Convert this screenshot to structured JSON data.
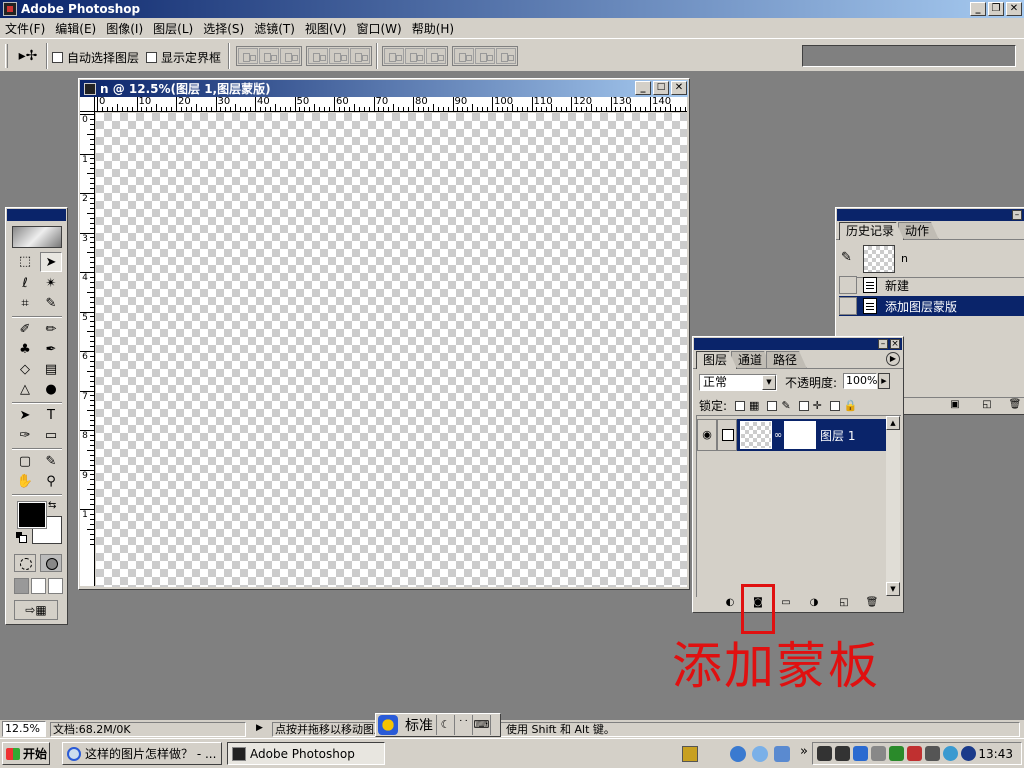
{
  "app": {
    "title": "Adobe Photoshop",
    "window_controls": [
      "_",
      "❐",
      "✕"
    ]
  },
  "menubar": {
    "items": [
      {
        "label": "文件(F)"
      },
      {
        "label": "编辑(E)"
      },
      {
        "label": "图像(I)"
      },
      {
        "label": "图层(L)"
      },
      {
        "label": "选择(S)"
      },
      {
        "label": "滤镜(T)"
      },
      {
        "label": "视图(V)"
      },
      {
        "label": "窗口(W)"
      },
      {
        "label": "帮助(H)"
      }
    ]
  },
  "options_bar": {
    "auto_select_label": "自动选择图层",
    "show_bounds_label": "显示定界框"
  },
  "document": {
    "title": "n @ 12.5%(图层 1,图层蒙版)",
    "ruler_top_labels": [
      "0",
      "10",
      "20",
      "30",
      "40",
      "50",
      "60",
      "70",
      "80",
      "90",
      "100",
      "110",
      "120",
      "130",
      "140"
    ],
    "ruler_left_labels": [
      "0",
      "1",
      "2",
      "3",
      "4",
      "5",
      "6",
      "7",
      "8",
      "9",
      "1"
    ]
  },
  "history_panel": {
    "tabs": [
      "历史记录",
      "动作"
    ],
    "snapshot_name": "n",
    "items": [
      "新建",
      "添加图层蒙版"
    ],
    "selected_index": 1
  },
  "layers_panel": {
    "tabs": [
      "图层",
      "通道",
      "路径"
    ],
    "blend_mode": "正常",
    "opacity_label": "不透明度:",
    "opacity_value": "100%",
    "lock_label": "锁定:",
    "layer_name": "图层 1"
  },
  "annotation": {
    "text": "添加蒙板",
    "color": "#e01010"
  },
  "status_bar": {
    "zoom": "12.5%",
    "doc_size": "文档:68.2M/0K",
    "hint": "点按并拖移以移动图层或选区。要用附加选项，使用 Shift 和 Alt 键。"
  },
  "ime": {
    "mode": "标准"
  },
  "taskbar": {
    "start_label": "开始",
    "tasks": [
      {
        "label": "这样的图片怎样做？ - ...",
        "icon": "ie-icon"
      },
      {
        "label": "Adobe Photoshop",
        "icon": "photoshop-icon"
      }
    ],
    "clock": "13:43",
    "chevron": "»"
  },
  "colors": {
    "titlebar_start": "#0a246a",
    "titlebar_end": "#a6caf0",
    "chrome": "#d4d0c8",
    "workspace": "#808080",
    "selection": "#0a246a",
    "foreground_color": "#000000",
    "background_color": "#ffffff"
  }
}
